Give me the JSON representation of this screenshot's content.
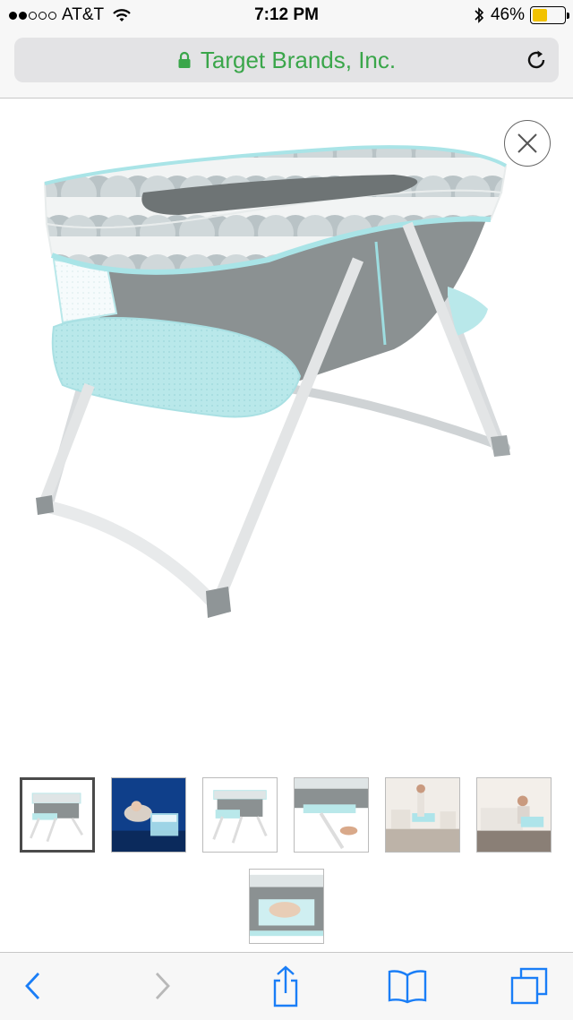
{
  "status_bar": {
    "carrier": "AT&T",
    "signal_bars_filled": 2,
    "signal_bars_total": 5,
    "time": "7:12 PM",
    "battery_percent": "46%",
    "battery_level": 0.46,
    "battery_color": "#f2c200"
  },
  "address_bar": {
    "site_title": "Target Brands, Inc.",
    "secure": true,
    "title_color": "#3aa64a"
  },
  "gallery": {
    "selected_index": 0,
    "thumbnail_count": 7
  },
  "toolbar": {
    "icons": [
      "back-icon",
      "forward-icon",
      "share-icon",
      "bookmarks-icon",
      "tabs-icon"
    ],
    "accent_color": "#1a7ef7"
  }
}
